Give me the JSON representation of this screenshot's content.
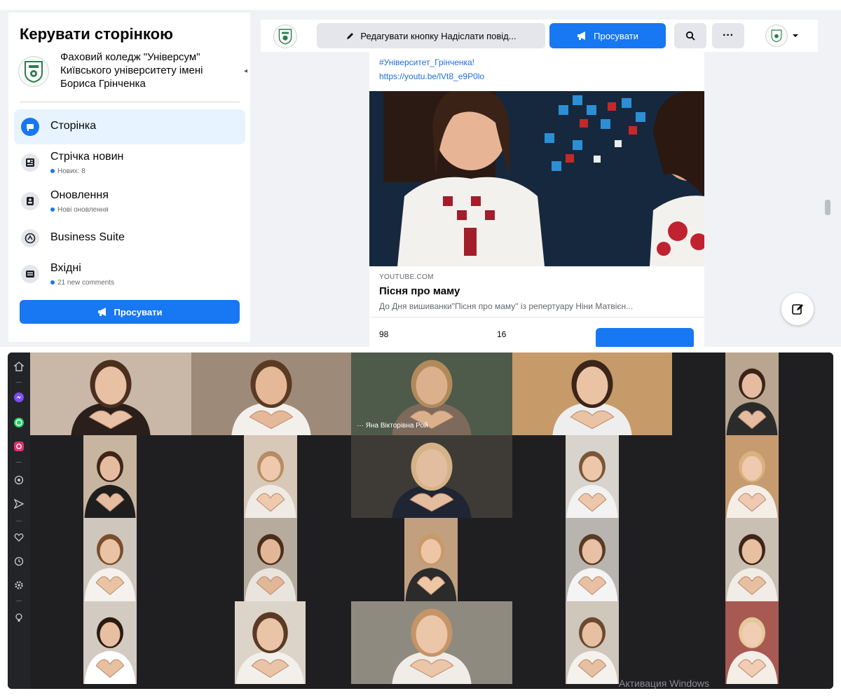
{
  "facebook": {
    "sidebar": {
      "title": "Керувати сторінкою",
      "page_name": "Фаховий коледж \"Універсум\" Київського університету імені Бориса Грінченка",
      "items": [
        {
          "label": "Сторінка",
          "sub": ""
        },
        {
          "label": "Стрічка новин",
          "sub": "Нових: 8"
        },
        {
          "label": "Оновлення",
          "sub": "Нові оновлення"
        },
        {
          "label": "Business Suite",
          "sub": ""
        },
        {
          "label": "Вхідні",
          "sub": "21 new comments"
        }
      ],
      "promote_label": "Просувати"
    },
    "toolbar": {
      "edit_label": "Редагувати кнопку Надіслати повід...",
      "promote_label": "Просувати",
      "more_label": "···"
    },
    "post": {
      "hashtag": "#Університет_Грінченка!",
      "url": "https://youtu.be/lVt8_e9P0lo",
      "link_source": "YOUTUBE.COM",
      "link_title": "Пісня про маму",
      "link_desc": "До Дня вишиванки\"Пісня про маму\" із репертуару Ніни Матвієн...",
      "stat_a": "98",
      "stat_b": "16"
    }
  },
  "video_call": {
    "speaker_name": "Яна Вікторівна Рой",
    "watermark": "Активация Windows"
  },
  "colors": {
    "fb_blue": "#1877f2",
    "fb_bg": "#f0f2f5",
    "link": "#216fdb",
    "call_bg": "#1f1f22",
    "speaker_border": "#35c5b8"
  },
  "icons": {
    "sidebar": [
      "flag-icon",
      "news-feed-icon",
      "updates-icon",
      "business-suite-icon",
      "inbox-icon"
    ],
    "call_bar": [
      "home-icon",
      "messenger-icon",
      "whatsapp-icon",
      "instagram-icon",
      "target-icon",
      "send-icon",
      "heart-icon",
      "clock-icon",
      "settings-icon",
      "bulb-icon"
    ]
  }
}
